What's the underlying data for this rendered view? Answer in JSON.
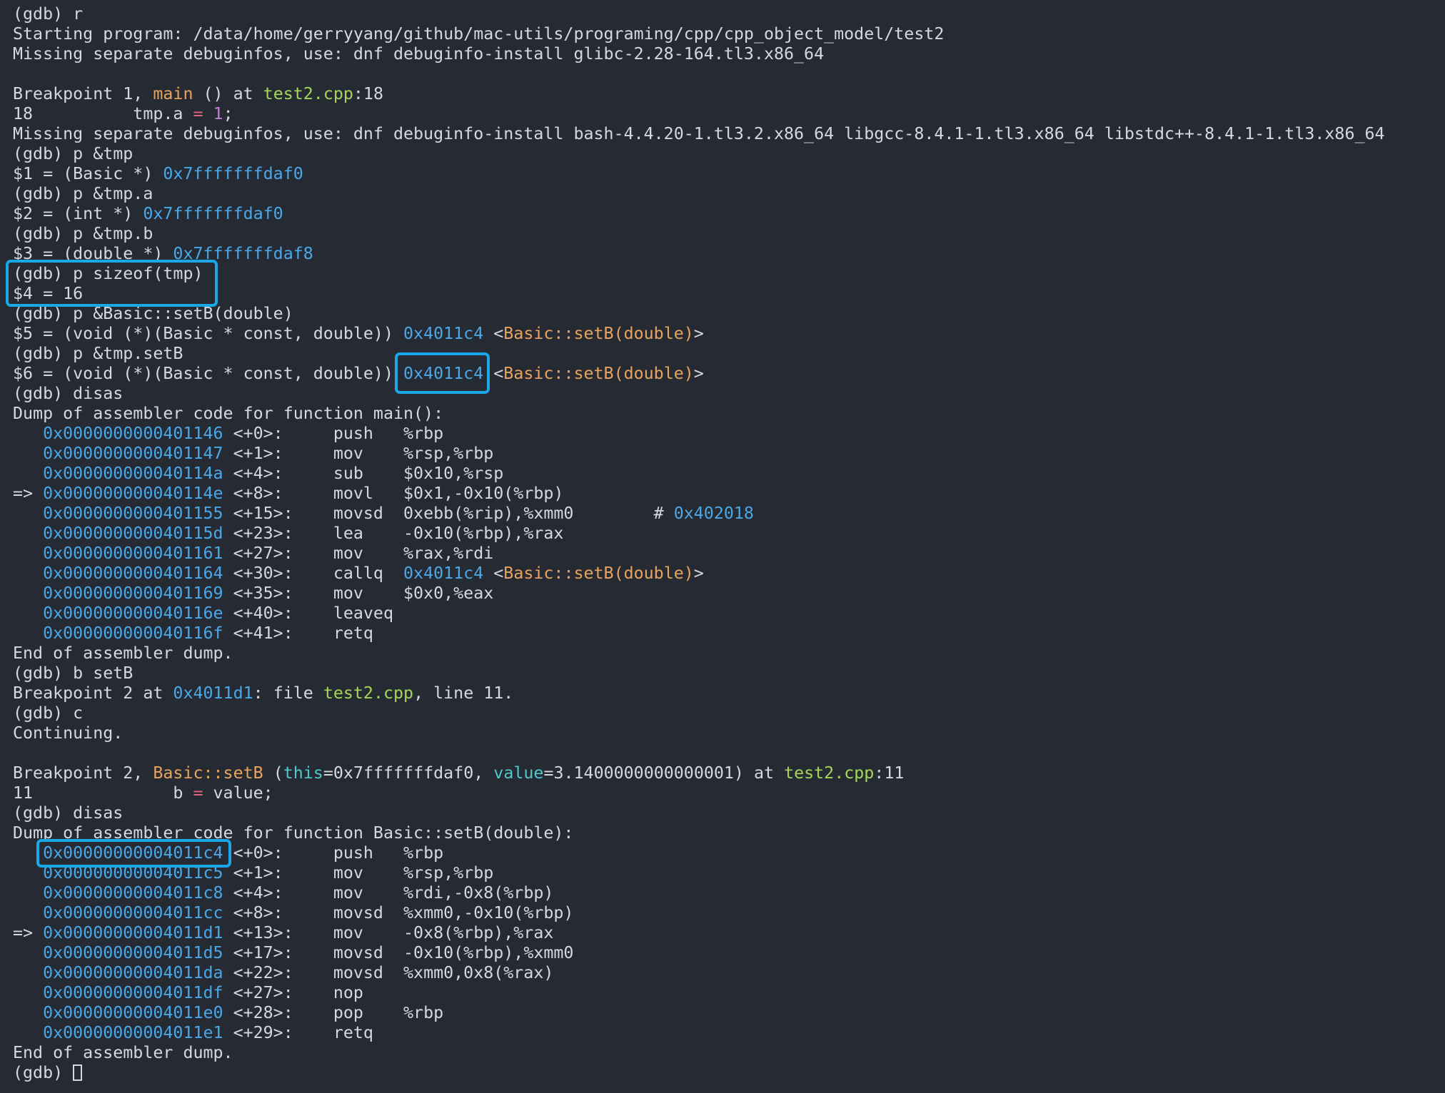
{
  "terminal": {
    "colors": {
      "background": "#262a33",
      "text": "#d4d8e0",
      "addr": "#4aa8e8",
      "func": "#e8a35c",
      "file": "#a5d65a",
      "param": "#4ec9c9",
      "num": "#c678dd",
      "op": "#e0647a",
      "highlight_box": "#19a7e6"
    },
    "lines": [
      [
        {
          "t": "(gdb) r",
          "c": "plain"
        }
      ],
      [
        {
          "t": "Starting program: /data/home/gerryyang/github/mac-utils/programing/cpp/cpp_object_model/test2",
          "c": "plain"
        }
      ],
      [
        {
          "t": "Missing separate debuginfos, use: dnf debuginfo-install glibc-2.28-164.tl3.x86_64",
          "c": "plain"
        }
      ],
      [],
      [
        {
          "t": "Breakpoint 1, ",
          "c": "plain"
        },
        {
          "t": "main",
          "c": "func"
        },
        {
          "t": " () at ",
          "c": "plain"
        },
        {
          "t": "test2.cpp",
          "c": "file"
        },
        {
          "t": ":18",
          "c": "plain"
        }
      ],
      [
        {
          "t": "18          tmp.a ",
          "c": "plain"
        },
        {
          "t": "=",
          "c": "op"
        },
        {
          "t": " ",
          "c": "plain"
        },
        {
          "t": "1",
          "c": "num"
        },
        {
          "t": ";",
          "c": "plain"
        }
      ],
      [
        {
          "t": "Missing separate debuginfos, use: dnf debuginfo-install bash-4.4.20-1.tl3.2.x86_64 libgcc-8.4.1-1.tl3.x86_64 libstdc++-8.4.1-1.tl3.x86_64",
          "c": "plain"
        }
      ],
      [
        {
          "t": "(gdb) p &tmp",
          "c": "plain"
        }
      ],
      [
        {
          "t": "$1 = (Basic *) ",
          "c": "plain"
        },
        {
          "t": "0x7fffffffdaf0",
          "c": "addr"
        }
      ],
      [
        {
          "t": "(gdb) p &tmp.a",
          "c": "plain"
        }
      ],
      [
        {
          "t": "$2 = (int *) ",
          "c": "plain"
        },
        {
          "t": "0x7fffffffdaf0",
          "c": "addr"
        }
      ],
      [
        {
          "t": "(gdb) p &tmp.b",
          "c": "plain"
        }
      ],
      [
        {
          "t": "$3 = (double *) ",
          "c": "plain"
        },
        {
          "t": "0x7fffffffdaf8",
          "c": "addr"
        }
      ],
      [
        {
          "t": "(gdb) p sizeof(tmp)",
          "c": "plain"
        }
      ],
      [
        {
          "t": "$4 = 16",
          "c": "plain"
        }
      ],
      [
        {
          "t": "(gdb) p &Basic::setB(double)",
          "c": "plain"
        }
      ],
      [
        {
          "t": "$5 = (void (*)(Basic * const, double)) ",
          "c": "plain"
        },
        {
          "t": "0x4011c4",
          "c": "addr"
        },
        {
          "t": " <",
          "c": "plain"
        },
        {
          "t": "Basic::setB(double)",
          "c": "func"
        },
        {
          "t": ">",
          "c": "plain"
        }
      ],
      [
        {
          "t": "(gdb) p &tmp.setB",
          "c": "plain"
        }
      ],
      [
        {
          "t": "$6 = (void (*)(Basic * const, double)) ",
          "c": "plain"
        },
        {
          "t": "0x4011c4",
          "c": "addr"
        },
        {
          "t": " <",
          "c": "plain"
        },
        {
          "t": "Basic::setB(double)",
          "c": "func"
        },
        {
          "t": ">",
          "c": "plain"
        }
      ],
      [
        {
          "t": "(gdb) disas",
          "c": "plain"
        }
      ],
      [
        {
          "t": "Dump of assembler code for function main():",
          "c": "plain"
        }
      ],
      [
        {
          "t": "   ",
          "c": "plain"
        },
        {
          "t": "0x0000000000401146",
          "c": "addr"
        },
        {
          "t": " <+0>:     push   %rbp",
          "c": "plain"
        }
      ],
      [
        {
          "t": "   ",
          "c": "plain"
        },
        {
          "t": "0x0000000000401147",
          "c": "addr"
        },
        {
          "t": " <+1>:     mov    %rsp,%rbp",
          "c": "plain"
        }
      ],
      [
        {
          "t": "   ",
          "c": "plain"
        },
        {
          "t": "0x000000000040114a",
          "c": "addr"
        },
        {
          "t": " <+4>:     sub    $0x10,%rsp",
          "c": "plain"
        }
      ],
      [
        {
          "t": "=> ",
          "c": "plain"
        },
        {
          "t": "0x000000000040114e",
          "c": "addr"
        },
        {
          "t": " <+8>:     movl   $0x1,-0x10(%rbp)",
          "c": "plain"
        }
      ],
      [
        {
          "t": "   ",
          "c": "plain"
        },
        {
          "t": "0x0000000000401155",
          "c": "addr"
        },
        {
          "t": " <+15>:    movsd  0xebb(%rip),%xmm0        # ",
          "c": "plain"
        },
        {
          "t": "0x402018",
          "c": "addr"
        }
      ],
      [
        {
          "t": "   ",
          "c": "plain"
        },
        {
          "t": "0x000000000040115d",
          "c": "addr"
        },
        {
          "t": " <+23>:    lea    -0x10(%rbp),%rax",
          "c": "plain"
        }
      ],
      [
        {
          "t": "   ",
          "c": "plain"
        },
        {
          "t": "0x0000000000401161",
          "c": "addr"
        },
        {
          "t": " <+27>:    mov    %rax,%rdi",
          "c": "plain"
        }
      ],
      [
        {
          "t": "   ",
          "c": "plain"
        },
        {
          "t": "0x0000000000401164",
          "c": "addr"
        },
        {
          "t": " <+30>:    callq  ",
          "c": "plain"
        },
        {
          "t": "0x4011c4",
          "c": "addr"
        },
        {
          "t": " <",
          "c": "plain"
        },
        {
          "t": "Basic::setB(double)",
          "c": "func"
        },
        {
          "t": ">",
          "c": "plain"
        }
      ],
      [
        {
          "t": "   ",
          "c": "plain"
        },
        {
          "t": "0x0000000000401169",
          "c": "addr"
        },
        {
          "t": " <+35>:    mov    $0x0,%eax",
          "c": "plain"
        }
      ],
      [
        {
          "t": "   ",
          "c": "plain"
        },
        {
          "t": "0x000000000040116e",
          "c": "addr"
        },
        {
          "t": " <+40>:    leaveq",
          "c": "plain"
        }
      ],
      [
        {
          "t": "   ",
          "c": "plain"
        },
        {
          "t": "0x000000000040116f",
          "c": "addr"
        },
        {
          "t": " <+41>:    retq",
          "c": "plain"
        }
      ],
      [
        {
          "t": "End of assembler dump.",
          "c": "plain"
        }
      ],
      [
        {
          "t": "(gdb) b setB",
          "c": "plain"
        }
      ],
      [
        {
          "t": "Breakpoint 2 at ",
          "c": "plain"
        },
        {
          "t": "0x4011d1",
          "c": "addr"
        },
        {
          "t": ": file ",
          "c": "plain"
        },
        {
          "t": "test2.cpp",
          "c": "file"
        },
        {
          "t": ", line 11.",
          "c": "plain"
        }
      ],
      [
        {
          "t": "(gdb) c",
          "c": "plain"
        }
      ],
      [
        {
          "t": "Continuing.",
          "c": "plain"
        }
      ],
      [],
      [
        {
          "t": "Breakpoint 2, ",
          "c": "plain"
        },
        {
          "t": "Basic::setB",
          "c": "func"
        },
        {
          "t": " (",
          "c": "plain"
        },
        {
          "t": "this",
          "c": "param"
        },
        {
          "t": "=0x7fffffffdaf0, ",
          "c": "plain"
        },
        {
          "t": "value",
          "c": "param"
        },
        {
          "t": "=3.1400000000000001) at ",
          "c": "plain"
        },
        {
          "t": "test2.cpp",
          "c": "file"
        },
        {
          "t": ":11",
          "c": "plain"
        }
      ],
      [
        {
          "t": "11              b ",
          "c": "plain"
        },
        {
          "t": "=",
          "c": "op"
        },
        {
          "t": " value;",
          "c": "plain"
        }
      ],
      [
        {
          "t": "(gdb) disas",
          "c": "plain"
        }
      ],
      [
        {
          "t": "Dump of assembler code for function Basic::setB(double):",
          "c": "plain"
        }
      ],
      [
        {
          "t": "   ",
          "c": "plain"
        },
        {
          "t": "0x00000000004011c4",
          "c": "addr"
        },
        {
          "t": " <+0>:     push   %rbp",
          "c": "plain"
        }
      ],
      [
        {
          "t": "   ",
          "c": "plain"
        },
        {
          "t": "0x00000000004011c5",
          "c": "addr"
        },
        {
          "t": " <+1>:     mov    %rsp,%rbp",
          "c": "plain"
        }
      ],
      [
        {
          "t": "   ",
          "c": "plain"
        },
        {
          "t": "0x00000000004011c8",
          "c": "addr"
        },
        {
          "t": " <+4>:     mov    %rdi,-0x8(%rbp)",
          "c": "plain"
        }
      ],
      [
        {
          "t": "   ",
          "c": "plain"
        },
        {
          "t": "0x00000000004011cc",
          "c": "addr"
        },
        {
          "t": " <+8>:     movsd  %xmm0,-0x10(%rbp)",
          "c": "plain"
        }
      ],
      [
        {
          "t": "=> ",
          "c": "plain"
        },
        {
          "t": "0x00000000004011d1",
          "c": "addr"
        },
        {
          "t": " <+13>:    mov    -0x8(%rbp),%rax",
          "c": "plain"
        }
      ],
      [
        {
          "t": "   ",
          "c": "plain"
        },
        {
          "t": "0x00000000004011d5",
          "c": "addr"
        },
        {
          "t": " <+17>:    movsd  -0x10(%rbp),%xmm0",
          "c": "plain"
        }
      ],
      [
        {
          "t": "   ",
          "c": "plain"
        },
        {
          "t": "0x00000000004011da",
          "c": "addr"
        },
        {
          "t": " <+22>:    movsd  %xmm0,0x8(%rax)",
          "c": "plain"
        }
      ],
      [
        {
          "t": "   ",
          "c": "plain"
        },
        {
          "t": "0x00000000004011df",
          "c": "addr"
        },
        {
          "t": " <+27>:    nop",
          "c": "plain"
        }
      ],
      [
        {
          "t": "   ",
          "c": "plain"
        },
        {
          "t": "0x00000000004011e0",
          "c": "addr"
        },
        {
          "t": " <+28>:    pop    %rbp",
          "c": "plain"
        }
      ],
      [
        {
          "t": "   ",
          "c": "plain"
        },
        {
          "t": "0x00000000004011e1",
          "c": "addr"
        },
        {
          "t": " <+29>:    retq",
          "c": "plain"
        }
      ],
      [
        {
          "t": "End of assembler dump.",
          "c": "plain"
        }
      ],
      [
        {
          "t": "(gdb) ",
          "c": "plain"
        },
        {
          "t": "",
          "c": "cursor"
        }
      ]
    ]
  }
}
